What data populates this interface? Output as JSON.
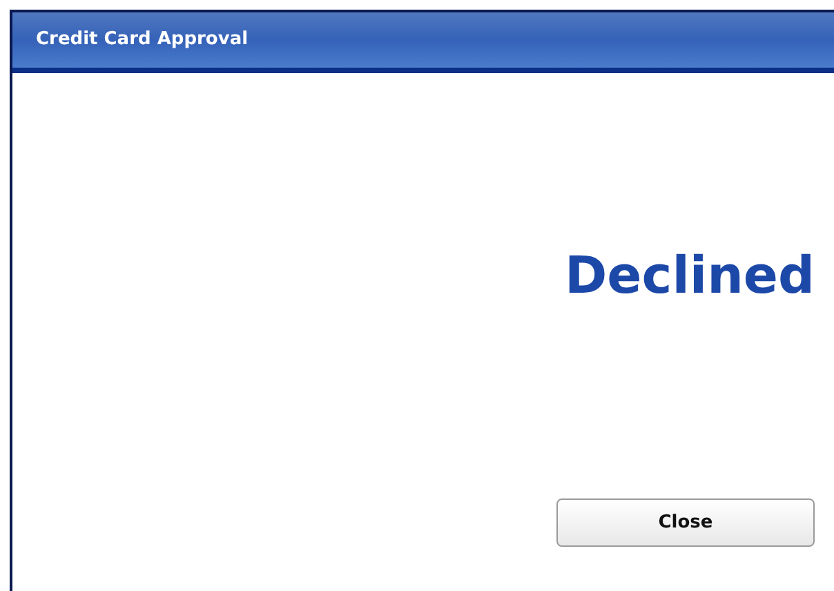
{
  "window": {
    "title": "Credit Card Approval"
  },
  "status": "Declined",
  "buttons": [
    "Close"
  ]
}
